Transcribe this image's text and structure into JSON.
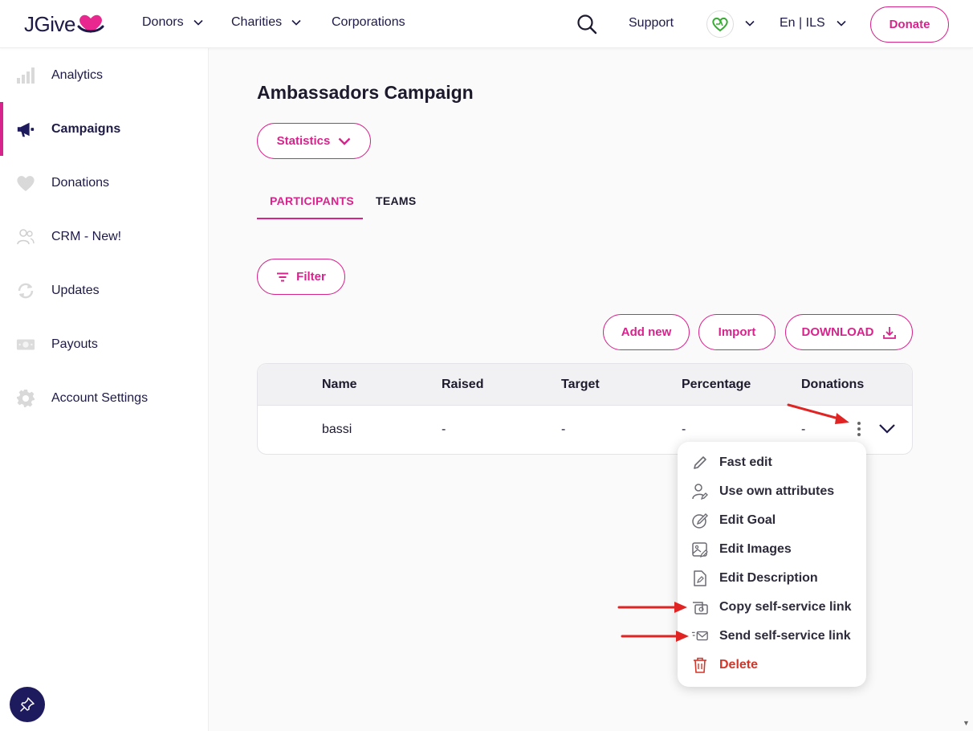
{
  "header": {
    "logo": "JGive",
    "nav": [
      {
        "label": "Donors",
        "has_dropdown": true
      },
      {
        "label": "Charities",
        "has_dropdown": true
      },
      {
        "label": "Corporations",
        "has_dropdown": false
      }
    ],
    "support_label": "Support",
    "language_label": "En | ILS",
    "donate_label": "Donate",
    "search_icon": "search-icon",
    "avatar_icon": "green-heart-avatar"
  },
  "sidebar": {
    "items": [
      {
        "label": "Analytics",
        "icon": "bar-chart-icon",
        "active": false
      },
      {
        "label": "Campaigns",
        "icon": "megaphone-icon",
        "active": true
      },
      {
        "label": "Donations",
        "icon": "heart-icon",
        "active": false
      },
      {
        "label": "CRM - New!",
        "icon": "users-icon",
        "active": false
      },
      {
        "label": "Updates",
        "icon": "refresh-icon",
        "active": false
      },
      {
        "label": "Payouts",
        "icon": "banknote-icon",
        "active": false
      },
      {
        "label": "Account Settings",
        "icon": "gear-icon",
        "active": false
      }
    ],
    "pin_icon": "pin-icon"
  },
  "main": {
    "title": "Ambassadors Campaign",
    "statistics_label": "Statistics",
    "tabs": [
      {
        "label": "PARTICIPANTS",
        "active": true
      },
      {
        "label": "TEAMS",
        "active": false
      }
    ],
    "filter_label": "Filter",
    "actions": {
      "add_new": "Add new",
      "import": "Import",
      "download": "DOWNLOAD"
    },
    "table": {
      "columns": [
        "Name",
        "Raised",
        "Target",
        "Percentage",
        "Donations"
      ],
      "rows": [
        {
          "name": "bassi",
          "raised": "-",
          "target": "-",
          "percentage": "-",
          "donations": "-"
        }
      ]
    },
    "row_menu": {
      "items": [
        {
          "label": "Fast edit",
          "icon": "pencil-icon",
          "danger": false
        },
        {
          "label": "Use own attributes",
          "icon": "user-edit-icon",
          "danger": false
        },
        {
          "label": "Edit Goal",
          "icon": "goal-edit-icon",
          "danger": false
        },
        {
          "label": "Edit Images",
          "icon": "image-edit-icon",
          "danger": false
        },
        {
          "label": "Edit Description",
          "icon": "document-edit-icon",
          "danger": false
        },
        {
          "label": "Copy self-service link",
          "icon": "copy-link-icon",
          "danger": false
        },
        {
          "label": "Send self-service link",
          "icon": "send-mail-icon",
          "danger": false
        },
        {
          "label": "Delete",
          "icon": "trash-icon",
          "danger": true
        }
      ]
    }
  },
  "colors": {
    "brand_pink": "#d6248c",
    "navy": "#1d1a47",
    "danger_red": "#d2372a",
    "annotation_red": "#e02424"
  }
}
